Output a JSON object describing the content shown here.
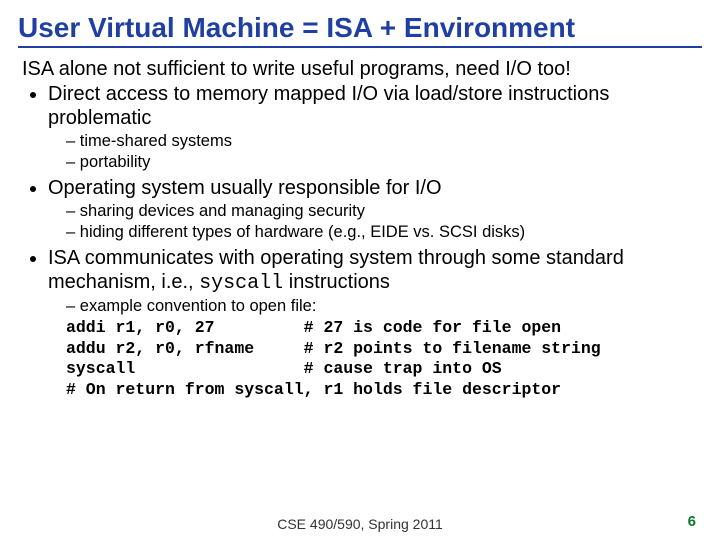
{
  "title": "User Virtual Machine = ISA + Environment",
  "intro": "ISA alone not sufficient to write useful programs, need I/O too!",
  "bullet1": "Direct access to memory mapped I/O via load/store instructions problematic",
  "sub1a": "time-shared systems",
  "sub1b": "portability",
  "bullet2": "Operating system usually responsible for I/O",
  "sub2a": "sharing devices and managing security",
  "sub2b": "hiding different types of hardware (e.g., EIDE vs. SCSI disks)",
  "bullet3_pre": "ISA communicates with operating system through some standard mechanism, i.e., ",
  "bullet3_code": "syscall",
  "bullet3_post": " instructions",
  "sub3a": "example convention to open file:",
  "code1": "addi r1, r0, 27         # 27 is code for file open",
  "code2": "addu r2, r0, rfname     # r2 points to filename string",
  "code3": "syscall                 # cause trap into OS",
  "code4": "# On return from syscall, r1 holds file descriptor",
  "footer": "CSE 490/590, Spring 2011",
  "page": "6"
}
